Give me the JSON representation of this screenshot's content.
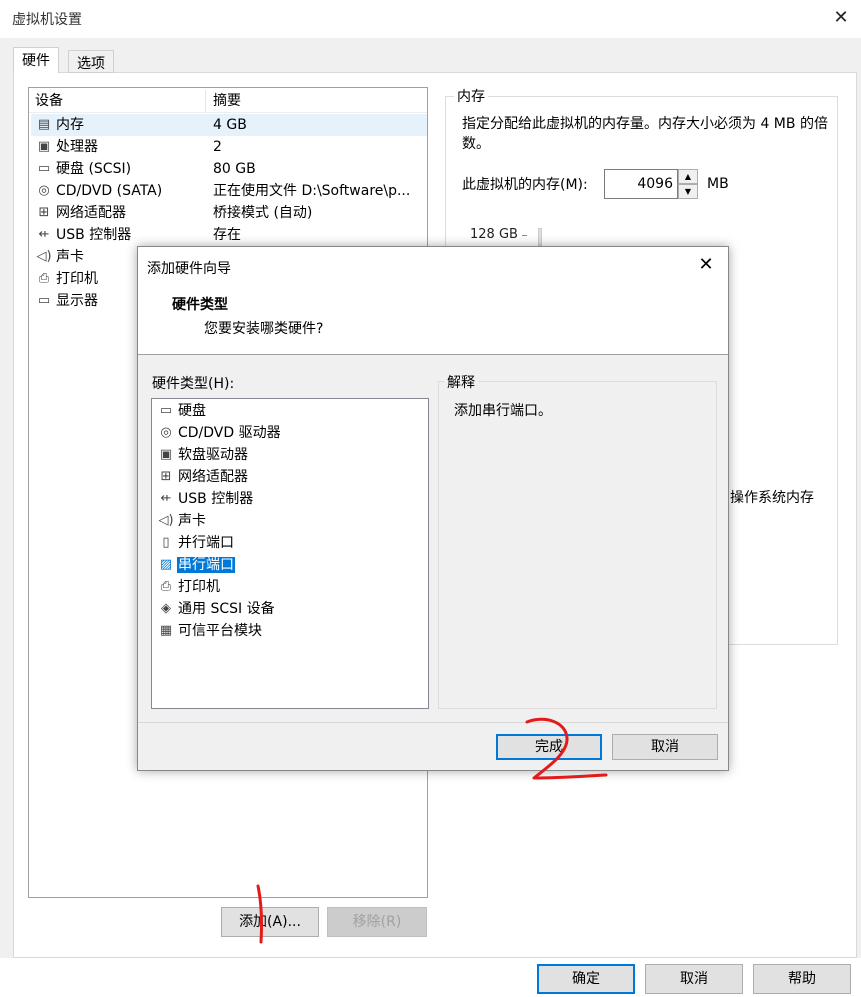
{
  "window": {
    "title": "虚拟机设置"
  },
  "tabs": [
    {
      "label": "硬件"
    },
    {
      "label": "选项"
    }
  ],
  "device_table": {
    "headers": [
      "设备",
      "摘要"
    ],
    "rows": [
      {
        "icon": "memory-icon",
        "name": "内存",
        "summary": "4 GB"
      },
      {
        "icon": "processor-icon",
        "name": "处理器",
        "summary": "2"
      },
      {
        "icon": "hard-disk-icon",
        "name": "硬盘 (SCSI)",
        "summary": "80 GB"
      },
      {
        "icon": "cd-dvd-icon",
        "name": "CD/DVD (SATA)",
        "summary": "正在使用文件 D:\\Software\\p..."
      },
      {
        "icon": "network-adapter-icon",
        "name": "网络适配器",
        "summary": "桥接模式 (自动)"
      },
      {
        "icon": "usb-icon",
        "name": "USB 控制器",
        "summary": "存在"
      },
      {
        "icon": "sound-icon",
        "name": "声卡",
        "summary": ""
      },
      {
        "icon": "printer-icon",
        "name": "打印机",
        "summary": ""
      },
      {
        "icon": "display-icon",
        "name": "显示器",
        "summary": ""
      }
    ]
  },
  "buttons": {
    "add": "添加(A)...",
    "remove": "移除(R)",
    "ok": "确定",
    "cancel": "取消",
    "help": "帮助"
  },
  "memory": {
    "group_label": "内存",
    "description": "指定分配给此虚拟机的内存量。内存大小必须为 4 MB 的倍数。",
    "field_label": "此虚拟机的内存(M):",
    "value": "4096",
    "unit": "MB",
    "scale_top": "128 GB",
    "note_partial": "操作系统内存"
  },
  "dialog": {
    "title": "添加硬件向导",
    "heading": "硬件类型",
    "subheading": "您要安装哪类硬件?",
    "list_label": "硬件类型(H):",
    "items": [
      {
        "icon": "hard-disk-icon",
        "label": "硬盘"
      },
      {
        "icon": "cd-dvd-icon",
        "label": "CD/DVD 驱动器"
      },
      {
        "icon": "floppy-icon",
        "label": "软盘驱动器"
      },
      {
        "icon": "network-adapter-icon",
        "label": "网络适配器"
      },
      {
        "icon": "usb-icon",
        "label": "USB 控制器"
      },
      {
        "icon": "sound-icon",
        "label": "声卡"
      },
      {
        "icon": "parallel-port-icon",
        "label": "并行端口"
      },
      {
        "icon": "serial-port-icon",
        "label": "串行端口"
      },
      {
        "icon": "printer-icon",
        "label": "打印机"
      },
      {
        "icon": "scsi-device-icon",
        "label": "通用 SCSI 设备"
      },
      {
        "icon": "tpm-icon",
        "label": "可信平台模块"
      }
    ],
    "selected_item": "串行端口",
    "explanation_label": "解释",
    "explanation_text": "添加串行端口。",
    "finish_button": "完成",
    "cancel_button": "取消"
  },
  "annotation_color": "#e21b1b"
}
